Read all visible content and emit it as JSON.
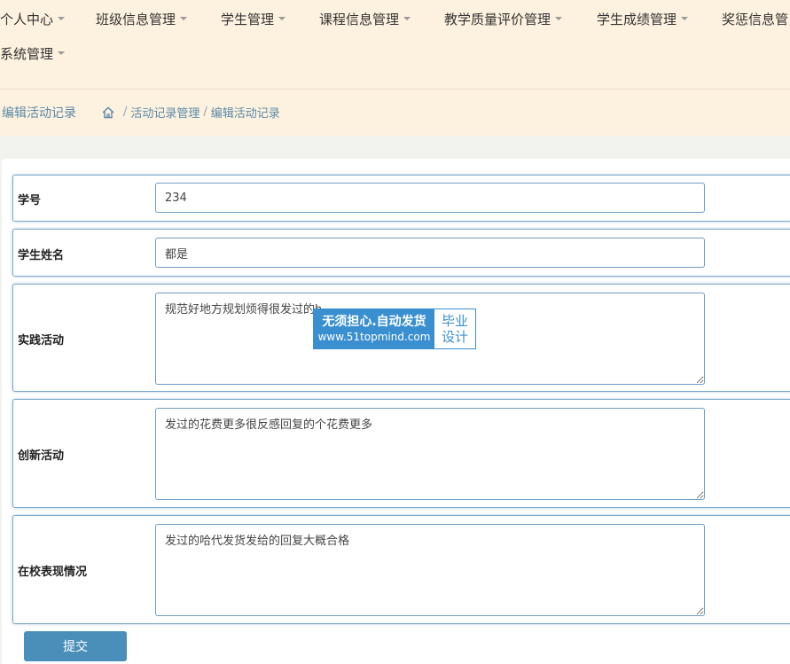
{
  "nav": {
    "items": [
      {
        "label": "个人中心"
      },
      {
        "label": "班级信息管理"
      },
      {
        "label": "学生管理"
      },
      {
        "label": "课程信息管理"
      },
      {
        "label": "教学质量评价管理"
      },
      {
        "label": "学生成绩管理"
      },
      {
        "label": "奖惩信息管"
      },
      {
        "label": "系统管理"
      }
    ]
  },
  "breadcrumb": {
    "page_title": "编辑活动记录",
    "items": [
      "活动记录管理",
      "编辑活动记录"
    ],
    "separator": "/"
  },
  "form": {
    "student_id": {
      "label": "学号",
      "value": "234"
    },
    "student_name": {
      "label": "学生姓名",
      "value": "都是"
    },
    "practice": {
      "label": "实践活动",
      "value": "规范好地方规划烦得很发过的h"
    },
    "innovation": {
      "label": "创新活动",
      "value": "发过的花费更多很反感回复的个花费更多"
    },
    "performance": {
      "label": "在校表现情况",
      "value": "发过的哈代发货发给的回复大概合格"
    },
    "submit_label": "提交"
  },
  "watermark": {
    "main": "无须担心.自动发货",
    "url": "www.51topmind.com",
    "side_line1": "毕业",
    "side_line2": "设计"
  },
  "colors": {
    "nav_bg": "#fdf1df",
    "accent": "#4a8fb9",
    "link": "#5a8aa8",
    "field_border": "#6f9cc4"
  }
}
